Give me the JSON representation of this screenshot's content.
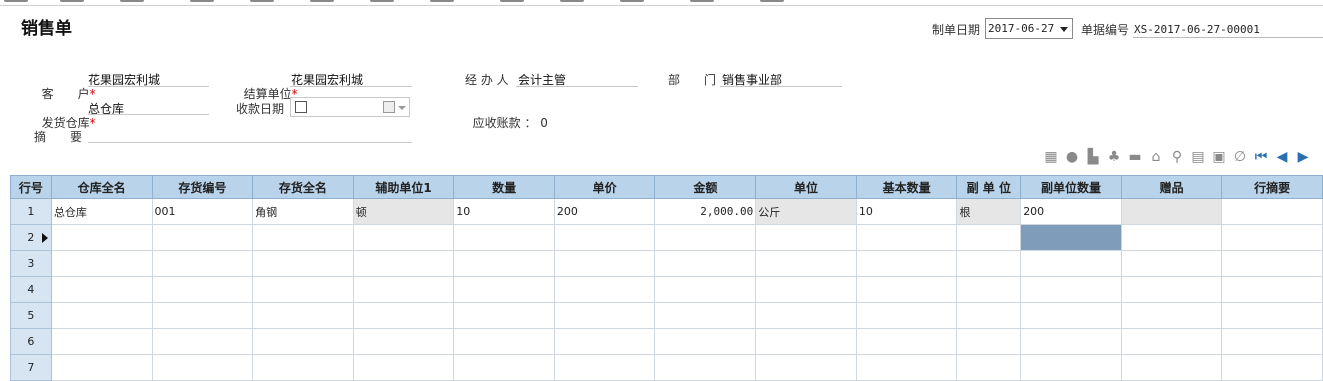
{
  "form": {
    "title": "销售单",
    "date_label": "制单日期",
    "date_value": "2017-06-27",
    "docno_label": "单据编号",
    "docno_value": "XS-2017-06-27-00001"
  },
  "fields": {
    "customer_label": "客　　户",
    "customer_value": "花果园宏利城",
    "settle_label": "结算单位",
    "settle_value": "花果园宏利城",
    "handler_label": "经 办 人",
    "handler_value": "会计主管",
    "dept_label": "部　　门",
    "dept_value": "销售事业部",
    "warehouse_label": "发货仓库",
    "warehouse_value": "总仓库",
    "recvdate_label": "收款日期",
    "receivable_label": "应收账款",
    "receivable_value": "0",
    "summary_label": "摘　　要",
    "required_mark": "*"
  },
  "toolbar_icons": [
    "qr-code-icon",
    "comment-icon",
    "chart-icon",
    "users-icon",
    "save-icon",
    "home-icon",
    "search-icon",
    "calculator-icon",
    "calendar-icon",
    "attachment-icon",
    "first-page-icon",
    "prev-icon",
    "next-icon"
  ],
  "table": {
    "headers": [
      "行号",
      "仓库全名",
      "存货编号",
      "存货全名",
      "辅助单位1",
      "数量",
      "单价",
      "金额",
      "单位",
      "基本数量",
      "副 单 位",
      "副单位数量",
      "赠品",
      "行摘要"
    ],
    "rows": [
      [
        "1",
        "总仓库",
        "001",
        "角钢",
        "顿",
        "10",
        "200",
        "2,000.00",
        "公斤",
        "10",
        "根",
        "200",
        "",
        ""
      ],
      [
        "2",
        "",
        "",
        "",
        "",
        "",
        "",
        "",
        "",
        "",
        "",
        "",
        "",
        ""
      ],
      [
        "3",
        "",
        "",
        "",
        "",
        "",
        "",
        "",
        "",
        "",
        "",
        "",
        "",
        ""
      ],
      [
        "4",
        "",
        "",
        "",
        "",
        "",
        "",
        "",
        "",
        "",
        "",
        "",
        "",
        ""
      ],
      [
        "5",
        "",
        "",
        "",
        "",
        "",
        "",
        "",
        "",
        "",
        "",
        "",
        "",
        ""
      ],
      [
        "6",
        "",
        "",
        "",
        "",
        "",
        "",
        "",
        "",
        "",
        "",
        "",
        "",
        ""
      ],
      [
        "7",
        "",
        "",
        "",
        "",
        "",
        "",
        "",
        "",
        "",
        "",
        "",
        "",
        ""
      ]
    ]
  }
}
